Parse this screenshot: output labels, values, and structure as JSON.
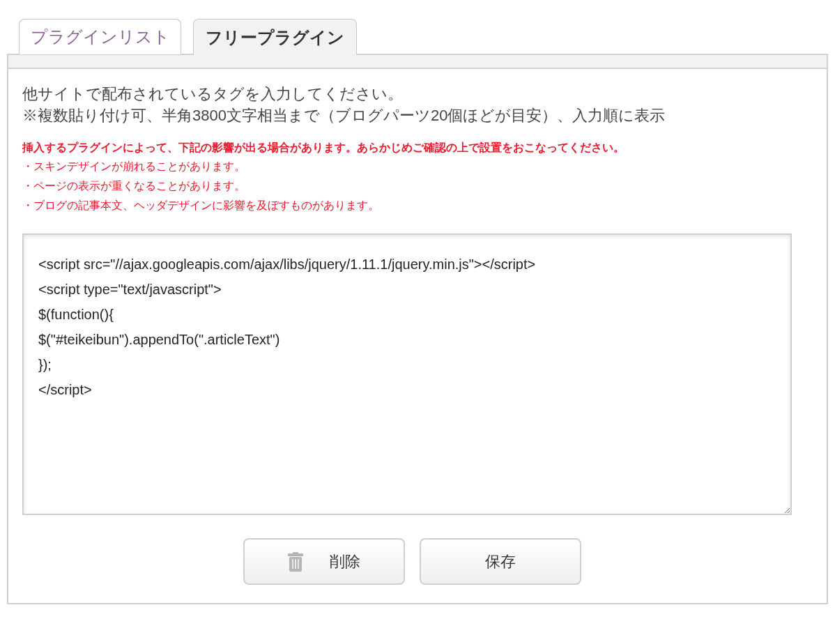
{
  "tabs": [
    {
      "label": "プラグインリスト",
      "selected": false
    },
    {
      "label": "フリープラグイン",
      "selected": true
    }
  ],
  "instructions": [
    "他サイトで配布されているタグを入力してください。",
    "※複数貼り付け可、半角3800文字相当まで（ブログパーツ20個ほどが目安）、入力順に表示"
  ],
  "warning": {
    "heading": "挿入するプラグインによって、下記の影響が出る場合があります。あらかじめご確認の上で設置をおこなってください。",
    "items": [
      "・スキンデザインが崩れることがあります。",
      "・ページの表示が重くなることがあります。",
      "・ブログの記事本文、ヘッダデザインに影響を及ぼすものがあります。"
    ]
  },
  "code_field": {
    "value": [
      "<script src=\"//ajax.googleapis.com/ajax/libs/jquery/1.11.1/jquery.min.js\"></script>",
      "<script type=\"text/javascript\">",
      "$(function(){",
      "$(\"#teikeibun\").appendTo(\".articleText\")",
      "});",
      "</script>"
    ]
  },
  "buttons": [
    {
      "kind": "delete",
      "label": "削除"
    },
    {
      "kind": "save",
      "label": "保存"
    }
  ]
}
